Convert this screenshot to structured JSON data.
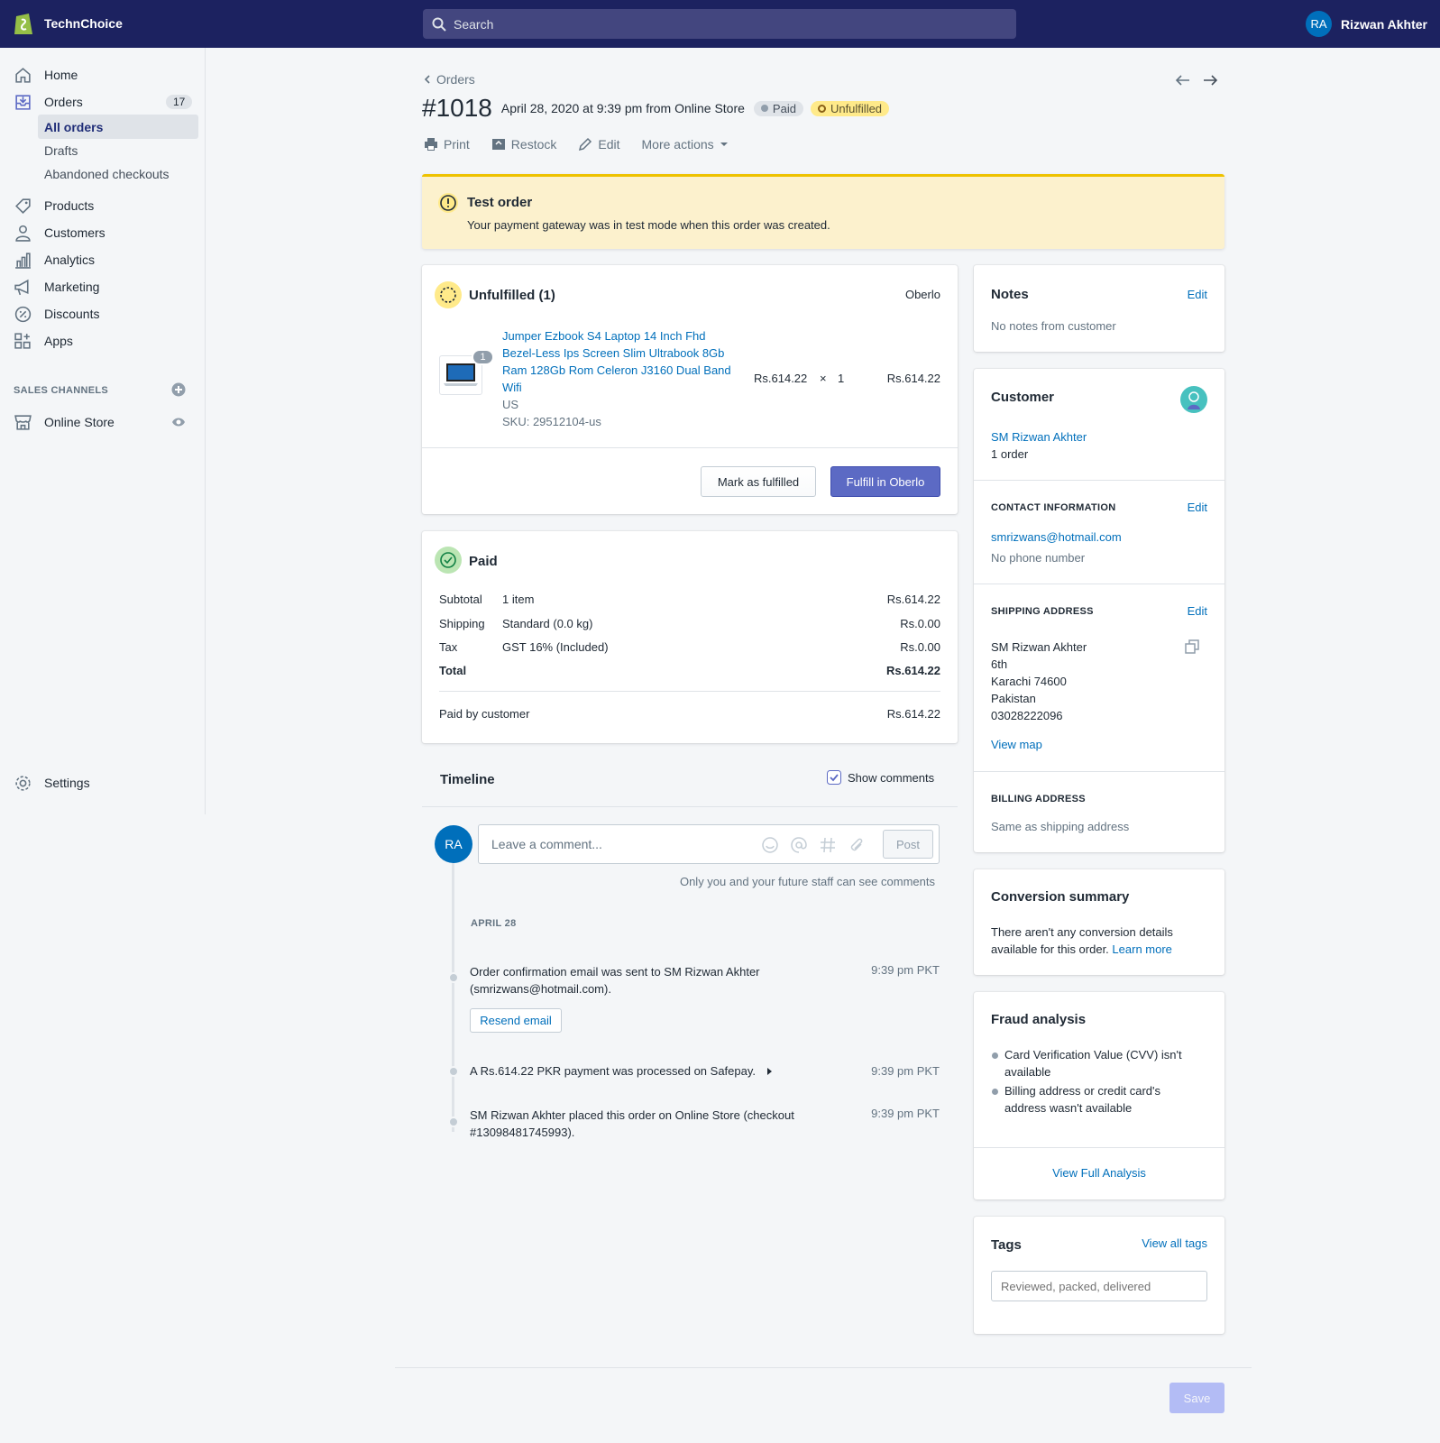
{
  "topbar": {
    "store_name": "TechnChoice",
    "search_placeholder": "Search",
    "user_initials": "RA",
    "user_name": "Rizwan Akhter"
  },
  "sidebar": {
    "items": [
      {
        "label": "Home",
        "icon": "home-icon"
      },
      {
        "label": "Orders",
        "icon": "orders-icon",
        "count": "17"
      },
      {
        "label": "Products",
        "icon": "tag-icon"
      },
      {
        "label": "Customers",
        "icon": "person-icon"
      },
      {
        "label": "Analytics",
        "icon": "bar-chart-icon"
      },
      {
        "label": "Marketing",
        "icon": "megaphone-icon"
      },
      {
        "label": "Discounts",
        "icon": "discount-icon"
      },
      {
        "label": "Apps",
        "icon": "apps-icon"
      }
    ],
    "order_sub": [
      "All orders",
      "Drafts",
      "Abandoned checkouts"
    ],
    "sales_channels_label": "SALES CHANNELS",
    "online_store": "Online Store",
    "settings": "Settings"
  },
  "order": {
    "breadcrumb": "Orders",
    "number": "#1018",
    "date": "April 28, 2020 at 9:39 pm from Online Store",
    "status_paid": "Paid",
    "status_unfulfilled": "Unfulfilled",
    "actions": {
      "print": "Print",
      "restock": "Restock",
      "edit": "Edit",
      "more": "More actions"
    }
  },
  "banner": {
    "title": "Test order",
    "text": "Your payment gateway was in test mode when this order was created."
  },
  "unfulfilled": {
    "title": "Unfulfilled (1)",
    "location": "Oberlo",
    "qty_badge": "1",
    "product_lines": [
      "Jumper Ezbook S4 Laptop 14 Inch Fhd",
      "Bezel-Less Ips Screen Slim Ultrabook 8Gb",
      "Ram 128Gb Rom Celeron J3160 Dual Band",
      "Wifi"
    ],
    "variant": "US",
    "sku": "SKU: 29512104-us",
    "unit_price": "Rs.614.22",
    "times": "×",
    "quantity": "1",
    "line_total": "Rs.614.22",
    "mark_button": "Mark as fulfilled",
    "fulfill_button": "Fulfill in Oberlo"
  },
  "paid": {
    "title": "Paid",
    "rows": [
      {
        "label": "Subtotal",
        "desc": "1 item",
        "amount": "Rs.614.22"
      },
      {
        "label": "Shipping",
        "desc": "Standard (0.0 kg)",
        "amount": "Rs.0.00"
      },
      {
        "label": "Tax",
        "desc": "GST 16% (Included)",
        "amount": "Rs.0.00"
      }
    ],
    "total_label": "Total",
    "total_amount": "Rs.614.22",
    "paid_by_label": "Paid by customer",
    "paid_by_amount": "Rs.614.22"
  },
  "timeline": {
    "title": "Timeline",
    "show_comments": "Show comments",
    "avatar": "RA",
    "comment_placeholder": "Leave a comment...",
    "post": "Post",
    "note": "Only you and your future staff can see comments",
    "date_label": "APRIL 28",
    "events": [
      {
        "lines": [
          "Order confirmation email was sent to SM Rizwan Akhter",
          "(smrizwans@hotmail.com)."
        ],
        "time": "9:39 pm PKT"
      },
      {
        "lines": [
          "A Rs.614.22 PKR payment was processed on Safepay."
        ],
        "time": "9:39 pm PKT"
      },
      {
        "lines": [
          "SM Rizwan Akhter placed this order on Online Store (checkout",
          "#13098481745993)."
        ],
        "time": "9:39 pm PKT"
      }
    ],
    "resend": "Resend email"
  },
  "notes": {
    "title": "Notes",
    "edit": "Edit",
    "text": "No notes from customer"
  },
  "customer": {
    "title": "Customer",
    "name": "SM Rizwan Akhter",
    "orders": "1 order",
    "contact_label": "CONTACT INFORMATION",
    "contact_edit": "Edit",
    "email": "smrizwans@hotmail.com",
    "phone": "No phone number",
    "shipping_label": "SHIPPING ADDRESS",
    "shipping_edit": "Edit",
    "address": [
      "SM Rizwan Akhter",
      "6th",
      "Karachi 74600",
      "Pakistan",
      "03028222096"
    ],
    "view_map": "View map",
    "billing_label": "BILLING ADDRESS",
    "billing_text": "Same as shipping address"
  },
  "conversion": {
    "title": "Conversion summary",
    "text1": "There aren't any conversion details",
    "text2": "available for this order.",
    "learn_more": "Learn more"
  },
  "fraud": {
    "title": "Fraud analysis",
    "items": [
      [
        "Card Verification Value (CVV) isn't",
        "available"
      ],
      [
        "Billing address or credit card's",
        "address wasn't available"
      ]
    ],
    "view_full": "View Full Analysis"
  },
  "tags": {
    "title": "Tags",
    "view_all": "View all tags",
    "placeholder": "Reviewed, packed, delivered"
  },
  "save": "Save",
  "colors": {
    "topbar": "#1c2260",
    "primary": "#5c6ac4",
    "link": "#006fbb",
    "banner": "#fcf1cd"
  }
}
